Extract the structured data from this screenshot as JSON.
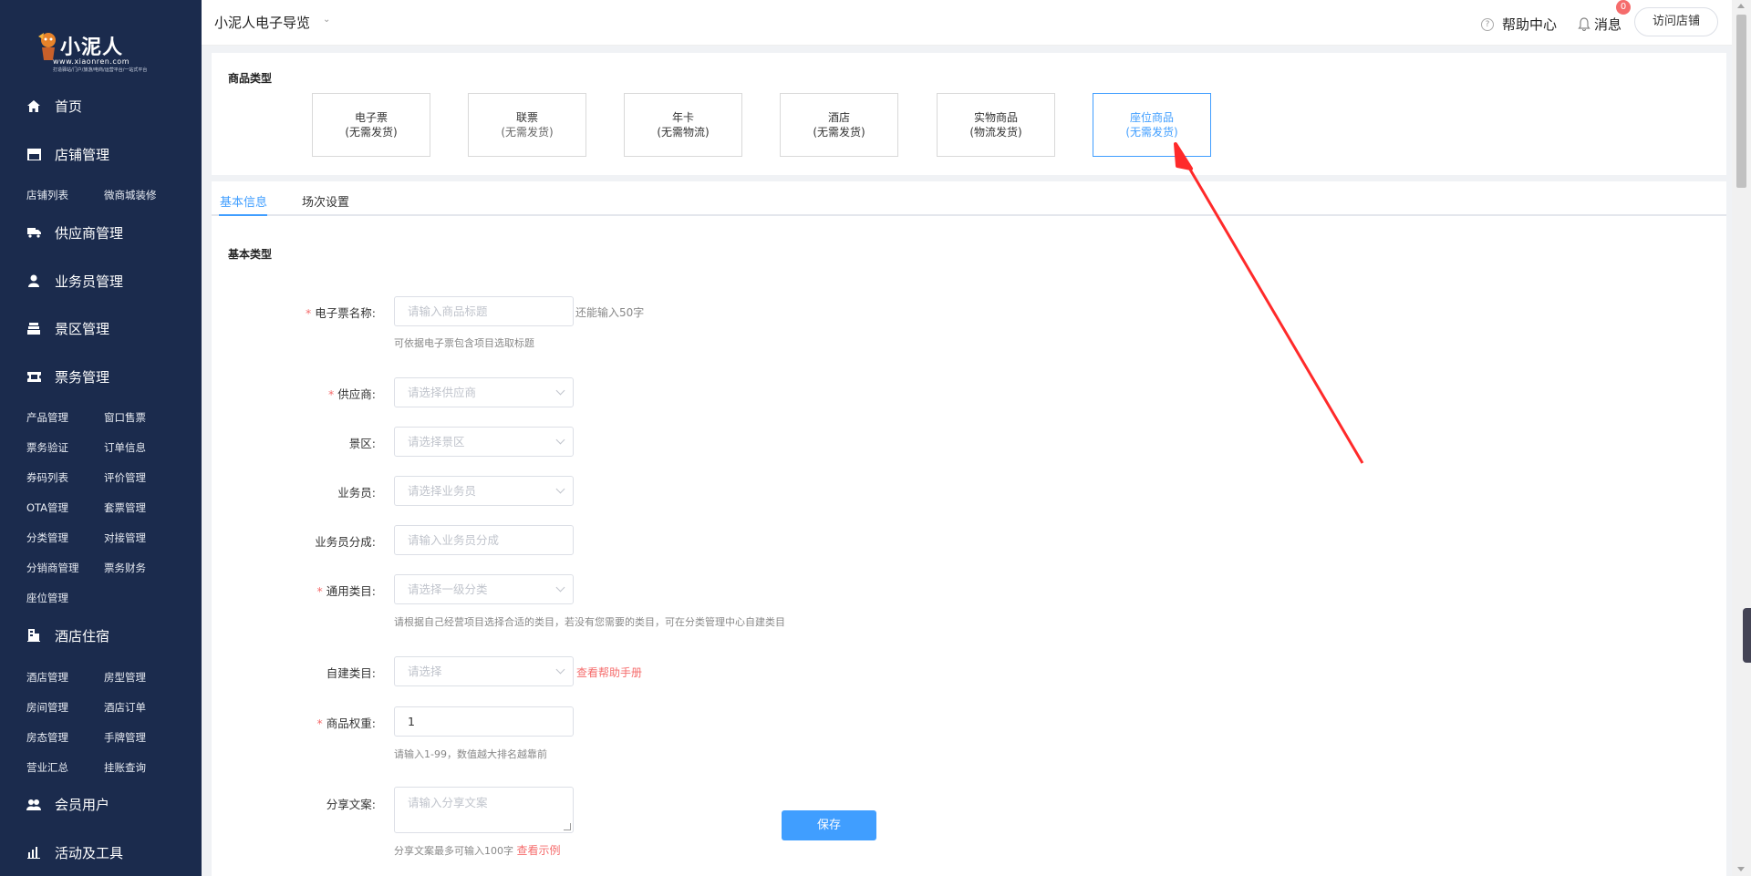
{
  "logo": {
    "brand": "小泥人",
    "domain": "www.xiaonren.com",
    "slogan": "打造驿站/门户/旅游/电商/运营平台/一站式平台"
  },
  "sidebar": {
    "groups": [
      {
        "label": "首页",
        "icon": "home-icon",
        "items": []
      },
      {
        "label": "店铺管理",
        "icon": "store-icon",
        "items": [
          "店铺列表",
          "微商城装修"
        ]
      },
      {
        "label": "供应商管理",
        "icon": "truck-icon",
        "items": []
      },
      {
        "label": "业务员管理",
        "icon": "user-icon",
        "items": []
      },
      {
        "label": "景区管理",
        "icon": "building-icon",
        "items": []
      },
      {
        "label": "票务管理",
        "icon": "ticket-icon",
        "items": [
          "产品管理",
          "窗口售票",
          "票务验证",
          "订单信息",
          "券码列表",
          "评价管理",
          "OTA管理",
          "套票管理",
          "分类管理",
          "对接管理",
          "分销商管理",
          "票务财务",
          "座位管理"
        ]
      },
      {
        "label": "酒店住宿",
        "icon": "hotel-icon",
        "items": [
          "酒店管理",
          "房型管理",
          "房间管理",
          "酒店订单",
          "房态管理",
          "手牌管理",
          "营业汇总",
          "挂账查询"
        ]
      },
      {
        "label": "会员用户",
        "icon": "users-icon",
        "items": []
      },
      {
        "label": "活动及工具",
        "icon": "chart-icon",
        "items": []
      }
    ]
  },
  "header": {
    "store_name": "小泥人电子导览",
    "help": "帮助中心",
    "message": "消息",
    "badge": "0",
    "visit": "访问店铺"
  },
  "product_type": {
    "title": "商品类型",
    "cards": [
      {
        "name": "电子票",
        "sub": "(无需发货)"
      },
      {
        "name": "联票",
        "sub": "(无需发货)"
      },
      {
        "name": "年卡",
        "sub": "(无需物流)"
      },
      {
        "name": "酒店",
        "sub": "(无需发货)"
      },
      {
        "name": "实物商品",
        "sub": "(物流发货)"
      },
      {
        "name": "座位商品",
        "sub": "(无需发货)",
        "active": true
      }
    ]
  },
  "tabs": [
    "基本信息",
    "场次设置"
  ],
  "form": {
    "section_title": "基本类型",
    "ticket_name": {
      "label": "电子票名称:",
      "placeholder": "请输入商品标题",
      "side": "还能输入50字",
      "hint": "可依据电子票包含项目选取标题"
    },
    "supplier": {
      "label": "供应商:",
      "placeholder": "请选择供应商"
    },
    "scenic": {
      "label": "景区:",
      "placeholder": "请选择景区"
    },
    "salesman": {
      "label": "业务员:",
      "placeholder": "请选择业务员"
    },
    "commission": {
      "label": "业务员分成:",
      "placeholder": "请输入业务员分成"
    },
    "category": {
      "label": "通用类目:",
      "placeholder": "请选择一级分类",
      "hint": "请根据自己经营项目选择合适的类目，若没有您需要的类目，可在分类管理中心自建类目"
    },
    "custom_category": {
      "label": "自建类目:",
      "placeholder": "请选择",
      "link": "查看帮助手册"
    },
    "weight": {
      "label": "商品权重:",
      "value": "1",
      "hint": "请输入1-99，数值越大排名越靠前"
    },
    "share": {
      "label": "分享文案:",
      "placeholder": "请输入分享文案",
      "hint": "分享文案最多可输入100字",
      "link": "查看示例"
    },
    "save": "保存"
  },
  "colors": {
    "sidebar_bg": "#1b2b4d",
    "primary": "#409eff",
    "danger": "#f56c6c",
    "annotation_arrow": "#ff2a2a"
  }
}
